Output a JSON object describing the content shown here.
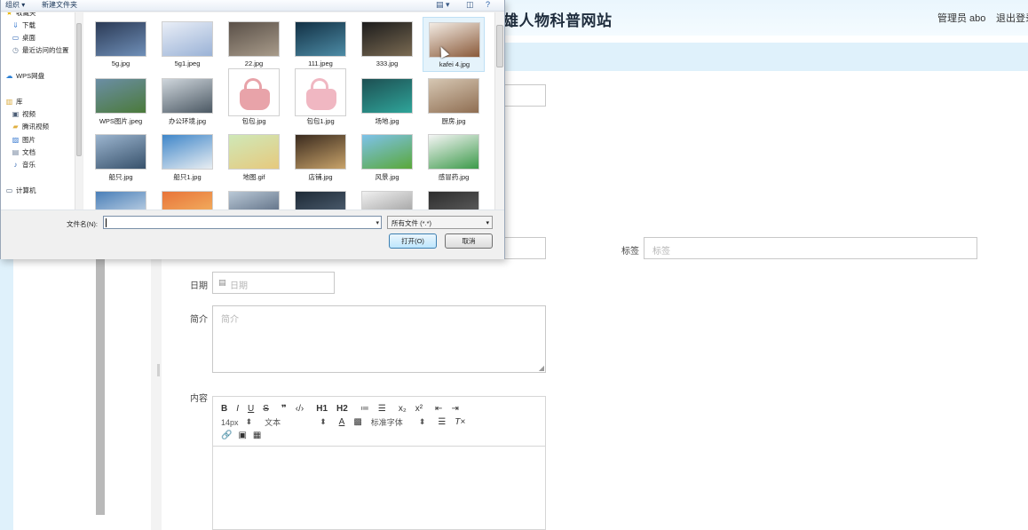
{
  "site": {
    "title": "雄人物科普网站",
    "admin_user": "管理员 abo",
    "logout": "退出登录"
  },
  "form": {
    "tag_label": "标签",
    "tag_placeholder": "标签",
    "date_label": "日期",
    "date_placeholder": "日期",
    "intro_label": "简介",
    "intro_placeholder": "简介",
    "content_label": "内容",
    "editor": {
      "row1": [
        "B",
        "I",
        "U",
        "S",
        "❞",
        "‹/›",
        "H1",
        "H2",
        "≔",
        "☰",
        "x₂",
        "x²",
        "⇤",
        "⇥"
      ],
      "font_size": "14px",
      "text_style": "文本",
      "font_family": "标准字体"
    }
  },
  "dialog": {
    "toolbar": {
      "organize": "组织 ▾",
      "new_folder": "新建文件夹"
    },
    "nav": [
      {
        "label": "收藏夹",
        "icon": "star-icon"
      },
      {
        "label": "下载",
        "icon": "download-folder-icon"
      },
      {
        "label": "桌面",
        "icon": "desktop-icon"
      },
      {
        "label": "最近访问的位置",
        "icon": "recent-places-icon"
      },
      {
        "label": "WPS网盘",
        "icon": "cloud-icon"
      },
      {
        "label": "库",
        "icon": "library-icon"
      },
      {
        "label": "视频",
        "icon": "video-icon"
      },
      {
        "label": "腾讯视频",
        "icon": "folder-icon"
      },
      {
        "label": "图片",
        "icon": "pictures-icon"
      },
      {
        "label": "文档",
        "icon": "documents-icon"
      },
      {
        "label": "音乐",
        "icon": "music-icon"
      },
      {
        "label": "计算机",
        "icon": "computer-icon"
      }
    ],
    "files": [
      {
        "name": "5g.jpg",
        "colors": [
          "#2b3a55",
          "#6f8fb8"
        ]
      },
      {
        "name": "5g1.jpeg",
        "colors": [
          "#e9eef7",
          "#9ab2d6"
        ]
      },
      {
        "name": "22.jpg",
        "colors": [
          "#5a5048",
          "#a89b8a"
        ]
      },
      {
        "name": "111.jpeg",
        "colors": [
          "#123044",
          "#4d8ca6"
        ]
      },
      {
        "name": "333.jpg",
        "colors": [
          "#1c1c1c",
          "#7a6a52"
        ]
      },
      {
        "name": "kafei 4.jpg",
        "colors": [
          "#f2ebe3",
          "#8a5a3a"
        ]
      },
      {
        "name": "WPS图片.jpeg",
        "colors": [
          "#6b8ea5",
          "#4b7a3a"
        ]
      },
      {
        "name": "办公环境.jpg",
        "colors": [
          "#cfd6dc",
          "#4b5863"
        ]
      },
      {
        "name": "包包.jpg",
        "colors": [
          "#ffffff",
          "#e8a3a9"
        ]
      },
      {
        "name": "包包1.jpg",
        "colors": [
          "#ffffff",
          "#f0b7c2"
        ]
      },
      {
        "name": "场地.jpg",
        "colors": [
          "#1d4f52",
          "#2fa59a"
        ]
      },
      {
        "name": "厨房.jpg",
        "colors": [
          "#d6c7b3",
          "#8f6e52"
        ]
      },
      {
        "name": "船只.jpg",
        "colors": [
          "#9cb5cf",
          "#37516b"
        ]
      },
      {
        "name": "船只1.jpg",
        "colors": [
          "#3f86c9",
          "#e9eef2"
        ]
      },
      {
        "name": "地图.gif",
        "colors": [
          "#cfe8b8",
          "#e6c97d"
        ]
      },
      {
        "name": "店铺.jpg",
        "colors": [
          "#3a2a1e",
          "#c8a36a"
        ]
      },
      {
        "name": "风景.jpg",
        "colors": [
          "#7ec2ea",
          "#5aa83a"
        ]
      },
      {
        "name": "感冒药.jpg",
        "colors": [
          "#f5f5f5",
          "#3c9a4a"
        ]
      },
      {
        "name": "",
        "colors": [
          "#4a7fb8",
          "#dfe8f0"
        ]
      },
      {
        "name": "",
        "colors": [
          "#e8743a",
          "#f5c16a"
        ]
      },
      {
        "name": "",
        "colors": [
          "#b9c8d6",
          "#42536b"
        ]
      },
      {
        "name": "",
        "colors": [
          "#1e2a36",
          "#5a6c80"
        ]
      },
      {
        "name": "",
        "colors": [
          "#f0f0f0",
          "#8a8a8a"
        ]
      },
      {
        "name": "",
        "colors": [
          "#2d2d2d",
          "#6a6a6a"
        ]
      }
    ],
    "filename_label": "文件名(N):",
    "filename_value": "",
    "filetype": "所有文件 (*.*)",
    "open_button": "打开(O)",
    "cancel_button": "取消"
  }
}
